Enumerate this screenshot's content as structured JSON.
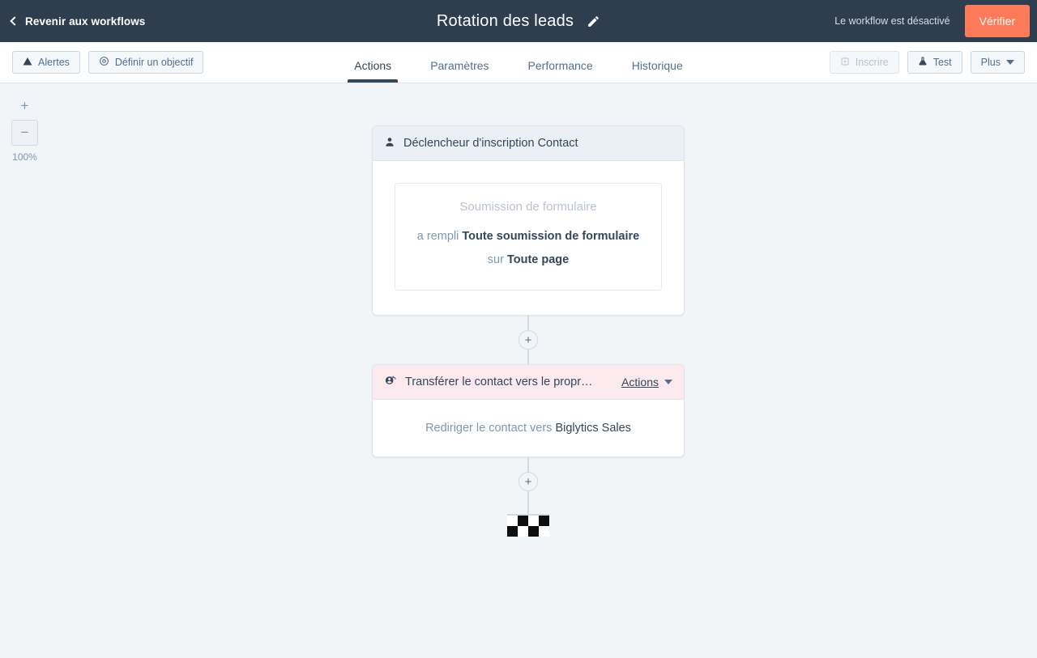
{
  "topbar": {
    "back_label": "Revenir aux workflows",
    "back_icon": "chevron-left-icon",
    "title": "Rotation des leads",
    "edit_icon": "pencil-icon",
    "status_text": "Le workflow est désactivé",
    "verify_label": "Vérifier",
    "accent_color": "#ff7a59",
    "background_color": "#2e3e4f"
  },
  "toolbar": {
    "alerts_label": "Alertes",
    "alerts_icon": "warning-triangle-icon",
    "goal_label": "Définir un objectif",
    "goal_icon": "target-icon",
    "enroll_label": "Inscrire",
    "enroll_icon": "enroll-icon",
    "test_label": "Test",
    "test_icon": "flask-icon",
    "more_label": "Plus",
    "more_icon": "chevron-down-icon",
    "tabs": [
      {
        "label": "Actions",
        "active": true
      },
      {
        "label": "Paramètres",
        "active": false
      },
      {
        "label": "Performance",
        "active": false
      },
      {
        "label": "Historique",
        "active": false
      }
    ]
  },
  "canvas": {
    "zoom_in_label": "+",
    "zoom_out_label": "−",
    "zoom_level": "100%"
  },
  "flow": {
    "trigger": {
      "header_label": "Déclencheur d'inscription Contact",
      "header_icon": "contact-icon",
      "header_color": "#eaf0f6",
      "inner_title": "Soumission de formulaire",
      "text_prefix": "a rempli ",
      "text_bold_1": "Toute soumission de formulaire",
      "text_middle": " sur ",
      "text_bold_2": "Toute page"
    },
    "add_step_icon": "plus-icon",
    "action": {
      "header_label": "Transférer le contact vers le propr…",
      "header_icon": "contact-rotate-icon",
      "header_color": "#fdeaee",
      "actions_menu_label": "Actions",
      "actions_menu_icon": "caret-down-icon",
      "body_prefix": "Rediriger le contact vers ",
      "body_bold": "Biglytics Sales"
    },
    "end_marker_icon": "checkered-flag-icon"
  }
}
